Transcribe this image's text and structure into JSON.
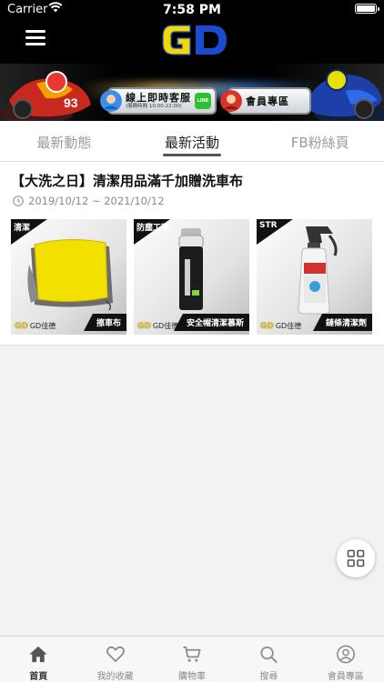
{
  "status_bar": {
    "carrier": "Carrier",
    "time": "7:58 PM"
  },
  "header": {
    "logo_text": "GD",
    "service_button": {
      "label": "線上即時客服",
      "hours": "(服務時間 10:00-22:00)",
      "line_label": "LINE"
    },
    "member_button": {
      "label": "會員專區"
    }
  },
  "tabs": [
    {
      "label": "最新動態",
      "active": false
    },
    {
      "label": "最新活動",
      "active": true
    },
    {
      "label": "FB粉絲頁",
      "active": false
    }
  ],
  "event": {
    "title": "【大洗之日】清潔用品滿千加贈洗車布",
    "date_range": "2019/10/12 ~ 2021/10/12",
    "products": [
      {
        "category": "清潔",
        "name": "擦車布",
        "brand": "GD佳德"
      },
      {
        "category": "防塵工事",
        "name": "安全帽清潔慕斯",
        "brand": "GD佳德"
      },
      {
        "category": "STR",
        "name": "鏈條清潔劑",
        "brand": "GD佳德"
      }
    ]
  },
  "bottom_nav": [
    {
      "label": "首頁",
      "icon": "home-icon",
      "active": true
    },
    {
      "label": "我的收藏",
      "icon": "heart-icon",
      "active": false
    },
    {
      "label": "購物車",
      "icon": "cart-icon",
      "active": false
    },
    {
      "label": "搜尋",
      "icon": "search-icon",
      "active": false
    },
    {
      "label": "會員專區",
      "icon": "user-icon",
      "active": false
    }
  ],
  "colors": {
    "header_bg": "#000000",
    "logo_yellow": "#f5d800",
    "logo_blue": "#1a4bd0",
    "line_green": "#2fbf33"
  }
}
